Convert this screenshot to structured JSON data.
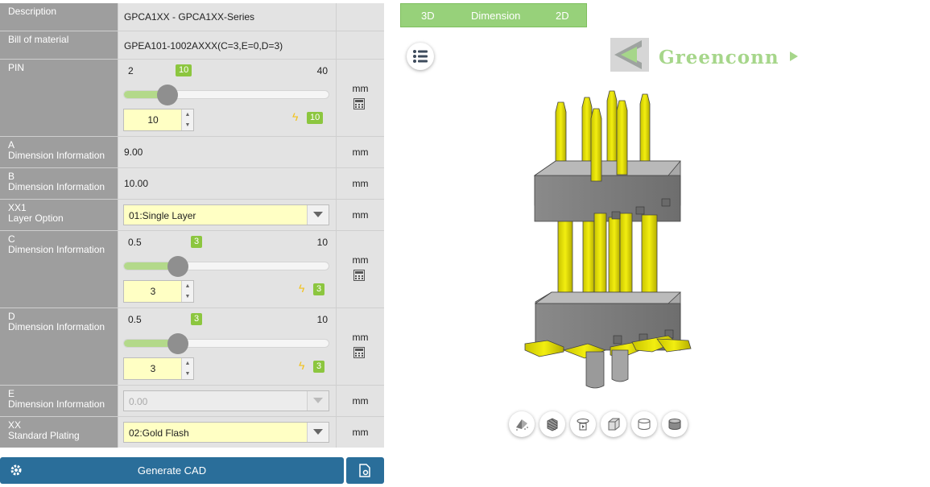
{
  "rows": {
    "description": {
      "label": "Description",
      "value": "GPCA1XX - GPCA1XX-Series"
    },
    "bom": {
      "label": "Bill of material",
      "value": "GPEA101-1002AXXX(C=3,E=0,D=3)"
    },
    "pin": {
      "label": "PIN",
      "min": "2",
      "max": "40",
      "badge": "10",
      "input": "10",
      "fast": "10",
      "unit": "mm",
      "fraction": 0.21
    },
    "a": {
      "label": "A",
      "sub": "Dimension Information",
      "value": "9.00",
      "unit": "mm"
    },
    "b": {
      "label": "B",
      "sub": "Dimension Information",
      "value": "10.00",
      "unit": "mm"
    },
    "xx1": {
      "label": "XX1",
      "sub": "Layer Option",
      "value": "01:Single Layer",
      "unit": "mm"
    },
    "c": {
      "label": "C",
      "sub": "Dimension Information",
      "min": "0.5",
      "max": "10",
      "badge": "3",
      "input": "3",
      "fast": "3",
      "unit": "mm",
      "fraction": 0.26
    },
    "d": {
      "label": "D",
      "sub": "Dimension Information",
      "min": "0.5",
      "max": "10",
      "badge": "3",
      "input": "3",
      "fast": "3",
      "unit": "mm",
      "fraction": 0.26
    },
    "e": {
      "label": "E",
      "sub": "Dimension Information",
      "value": "0.00",
      "unit": "mm"
    },
    "xx": {
      "label": "XX",
      "sub": "Standard Plating",
      "value": "02:Gold Flash",
      "unit": "mm"
    }
  },
  "buttons": {
    "generate": "Generate CAD"
  },
  "tabs": [
    "3D",
    "Dimension",
    "2D"
  ],
  "logo": {
    "text": "Greenconn"
  },
  "viewer_tools": [
    "explode-icon",
    "section-icon",
    "rotate-icon",
    "box-view-icon",
    "cylinder-outline-icon",
    "cylinder-solid-icon"
  ],
  "colors": {
    "accent": "#8cc63f",
    "button": "#2a6e9a",
    "input_bg": "#ffffc4",
    "pin_gold": "#e6e000",
    "housing": "#7d7d7d"
  }
}
